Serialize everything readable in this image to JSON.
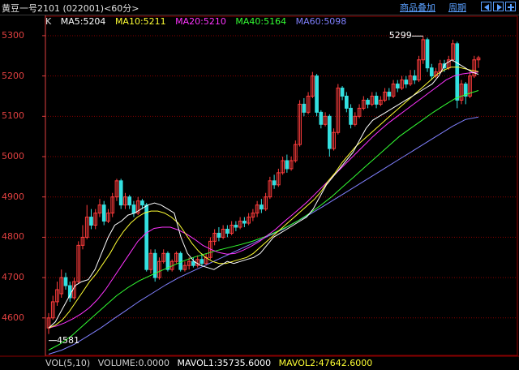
{
  "window": {
    "title": "黄豆一号2101 (022001)<60分>",
    "overlay_label": "商品叠加",
    "period_label": "周期"
  },
  "legend": {
    "k": "K",
    "ma5": "MA5:5204",
    "ma10": "MA10:5211",
    "ma20": "MA20:5210",
    "ma40": "MA40:5164",
    "ma60": "MA60:5098"
  },
  "volume": {
    "label": "VOL(5,10)",
    "volume": "VOLUME:0.0000",
    "mavol1": "MAVOL1:35735.6000",
    "mavol2": "MAVOL2:47642.6000"
  },
  "annotations": {
    "high": "5299",
    "low": "4581"
  },
  "colors": {
    "background": "#000000",
    "up": "#ff3c3c",
    "down": "#33e0e0",
    "grid": "#8b0000",
    "axis": "#e04040",
    "ma5": "#ffffff",
    "ma10": "#ffff33",
    "ma20": "#ff33ff",
    "ma40": "#33ff33",
    "ma60": "#8080ff"
  },
  "chart_data": {
    "type": "candlestick",
    "ylim": [
      4505,
      5320
    ],
    "y_ticks": [
      "5300",
      "5200",
      "5100",
      "5000",
      "4900",
      "4800",
      "4700",
      "4600"
    ],
    "candles": [
      [
        4575,
        4600,
        4560,
        4612
      ],
      [
        4600,
        4640,
        4595,
        4655
      ],
      [
        4640,
        4670,
        4630,
        4690
      ],
      [
        4660,
        4700,
        4650,
        4720
      ],
      [
        4700,
        4680,
        4670,
        4712
      ],
      [
        4680,
        4650,
        4640,
        4690
      ],
      [
        4650,
        4690,
        4645,
        4700
      ],
      [
        4690,
        4780,
        4685,
        4790
      ],
      [
        4780,
        4800,
        4770,
        4830
      ],
      [
        4800,
        4850,
        4795,
        4880
      ],
      [
        4850,
        4830,
        4820,
        4870
      ],
      [
        4830,
        4860,
        4820,
        4870
      ],
      [
        4860,
        4880,
        4850,
        4895
      ],
      [
        4880,
        4840,
        4830,
        4890
      ],
      [
        4840,
        4860,
        4835,
        4870
      ],
      [
        4860,
        4900,
        4850,
        4910
      ],
      [
        4900,
        4940,
        4890,
        4945
      ],
      [
        4940,
        4880,
        4870,
        4945
      ],
      [
        4880,
        4900,
        4870,
        4910
      ],
      [
        4900,
        4880,
        4870,
        4905
      ],
      [
        4880,
        4860,
        4850,
        4890
      ],
      [
        4860,
        4890,
        4855,
        4900
      ],
      [
        4890,
        4880,
        4870,
        4895
      ],
      [
        4880,
        4720,
        4715,
        4885
      ],
      [
        4720,
        4760,
        4710,
        4770
      ],
      [
        4760,
        4700,
        4690,
        4770
      ],
      [
        4700,
        4740,
        4695,
        4750
      ],
      [
        4740,
        4760,
        4735,
        4770
      ],
      [
        4760,
        4720,
        4715,
        4765
      ],
      [
        4720,
        4740,
        4715,
        4745
      ],
      [
        4740,
        4760,
        4735,
        4765
      ],
      [
        4760,
        4720,
        4715,
        4765
      ],
      [
        4720,
        4730,
        4715,
        4740
      ],
      [
        4730,
        4740,
        4720,
        4750
      ],
      [
        4740,
        4730,
        4725,
        4750
      ],
      [
        4730,
        4745,
        4725,
        4755
      ],
      [
        4745,
        4735,
        4730,
        4760
      ],
      [
        4735,
        4750,
        4730,
        4760
      ],
      [
        4750,
        4790,
        4745,
        4800
      ],
      [
        4790,
        4810,
        4780,
        4820
      ],
      [
        4810,
        4800,
        4790,
        4825
      ],
      [
        4800,
        4820,
        4795,
        4830
      ],
      [
        4820,
        4810,
        4800,
        4830
      ],
      [
        4810,
        4830,
        4805,
        4840
      ],
      [
        4830,
        4825,
        4815,
        4840
      ],
      [
        4825,
        4840,
        4820,
        4850
      ],
      [
        4840,
        4835,
        4825,
        4850
      ],
      [
        4835,
        4850,
        4830,
        4860
      ],
      [
        4850,
        4860,
        4840,
        4870
      ],
      [
        4860,
        4880,
        4850,
        4890
      ],
      [
        4880,
        4870,
        4860,
        4895
      ],
      [
        4870,
        4900,
        4865,
        4910
      ],
      [
        4900,
        4940,
        4895,
        4950
      ],
      [
        4940,
        4930,
        4920,
        4955
      ],
      [
        4930,
        4960,
        4925,
        4970
      ],
      [
        4960,
        4990,
        4955,
        5000
      ],
      [
        4990,
        4970,
        4960,
        5005
      ],
      [
        4970,
        4990,
        4965,
        5000
      ],
      [
        4990,
        5030,
        4985,
        5040
      ],
      [
        5030,
        5130,
        5025,
        5140
      ],
      [
        5130,
        5110,
        5100,
        5145
      ],
      [
        5110,
        5150,
        5105,
        5160
      ],
      [
        5150,
        5200,
        5145,
        5210
      ],
      [
        5200,
        5110,
        5100,
        5205
      ],
      [
        5110,
        5080,
        5070,
        5115
      ],
      [
        5080,
        5100,
        5075,
        5110
      ],
      [
        5100,
        5020,
        5000,
        5105
      ],
      [
        5020,
        5060,
        5015,
        5070
      ],
      [
        5060,
        5170,
        5055,
        5180
      ],
      [
        5170,
        5150,
        5140,
        5175
      ],
      [
        5150,
        5120,
        5110,
        5160
      ],
      [
        5120,
        5080,
        5070,
        5130
      ],
      [
        5080,
        5100,
        5075,
        5110
      ],
      [
        5100,
        5120,
        5095,
        5130
      ],
      [
        5120,
        5140,
        5115,
        5150
      ],
      [
        5140,
        5130,
        5120,
        5145
      ],
      [
        5130,
        5150,
        5125,
        5160
      ],
      [
        5150,
        5130,
        5120,
        5160
      ],
      [
        5130,
        5140,
        5125,
        5150
      ],
      [
        5140,
        5160,
        5135,
        5170
      ],
      [
        5160,
        5150,
        5140,
        5170
      ],
      [
        5150,
        5180,
        5145,
        5190
      ],
      [
        5180,
        5170,
        5160,
        5190
      ],
      [
        5170,
        5190,
        5165,
        5200
      ],
      [
        5190,
        5180,
        5170,
        5200
      ],
      [
        5180,
        5200,
        5175,
        5215
      ],
      [
        5200,
        5190,
        5180,
        5215
      ],
      [
        5190,
        5240,
        5185,
        5250
      ],
      [
        5240,
        5290,
        5230,
        5299
      ],
      [
        5290,
        5220,
        5210,
        5295
      ],
      [
        5220,
        5200,
        5190,
        5230
      ],
      [
        5200,
        5210,
        5195,
        5220
      ],
      [
        5210,
        5230,
        5205,
        5240
      ],
      [
        5230,
        5220,
        5210,
        5240
      ],
      [
        5220,
        5240,
        5215,
        5250
      ],
      [
        5240,
        5280,
        5235,
        5290
      ],
      [
        5280,
        5140,
        5120,
        5285
      ],
      [
        5140,
        5180,
        5130,
        5190
      ],
      [
        5180,
        5150,
        5130,
        5185
      ],
      [
        5150,
        5200,
        5145,
        5210
      ],
      [
        5200,
        5240,
        5195,
        5250
      ],
      [
        5240,
        5245,
        5220,
        5250
      ]
    ],
    "ma5": [
      4575,
      4590,
      4620,
      4650,
      4680,
      4690,
      4695,
      4720,
      4760,
      4800,
      4830,
      4840,
      4855,
      4860,
      4870,
      4880,
      4885,
      4880,
      4870,
      4860,
      4800,
      4760,
      4740,
      4730,
      4725,
      4720,
      4730,
      4740,
      4735,
      4740,
      4745,
      4750,
      4760,
      4780,
      4800,
      4810,
      4820,
      4830,
      4840,
      4850,
      4870,
      4900,
      4930,
      4950,
      4970,
      4990,
      5010,
      5040,
      5070,
      5090,
      5100,
      5110,
      5120,
      5130,
      5140,
      5150,
      5160,
      5170,
      5180,
      5200,
      5230,
      5240,
      5230,
      5220,
      5210,
      5204
    ],
    "ma10": [
      4575,
      4582,
      4595,
      4615,
      4640,
      4665,
      4690,
      4710,
      4735,
      4760,
      4790,
      4815,
      4835,
      4850,
      4860,
      4865,
      4865,
      4860,
      4850,
      4835,
      4810,
      4785,
      4765,
      4750,
      4740,
      4735,
      4735,
      4740,
      4745,
      4750,
      4760,
      4775,
      4790,
      4805,
      4820,
      4835,
      4850,
      4865,
      4880,
      4895,
      4915,
      4940,
      4960,
      4985,
      5005,
      5025,
      5040,
      5055,
      5070,
      5085,
      5100,
      5115,
      5130,
      5145,
      5160,
      5175,
      5190,
      5205,
      5215,
      5222,
      5222,
      5218,
      5214,
      5211
    ],
    "ma20": [
      4575,
      4580,
      4588,
      4598,
      4610,
      4625,
      4645,
      4670,
      4700,
      4730,
      4760,
      4790,
      4810,
      4822,
      4825,
      4825,
      4818,
      4808,
      4795,
      4780,
      4770,
      4762,
      4758,
      4760,
      4768,
      4778,
      4790,
      4805,
      4820,
      4838,
      4855,
      4872,
      4890,
      4910,
      4930,
      4950,
      4970,
      4990,
      5010,
      5030,
      5050,
      5068,
      5085,
      5100,
      5115,
      5130,
      5145,
      5160,
      5175,
      5190,
      5200,
      5205,
      5208,
      5210
    ],
    "ma40": [
      4520,
      4535,
      4555,
      4580,
      4605,
      4630,
      4655,
      4675,
      4692,
      4705,
      4718,
      4730,
      4742,
      4752,
      4760,
      4768,
      4775,
      4782,
      4790,
      4800,
      4812,
      4825,
      4840,
      4858,
      4878,
      4900,
      4925,
      4950,
      4975,
      5000,
      5025,
      5050,
      5070,
      5090,
      5110,
      5128,
      5145,
      5155,
      5164
    ],
    "ma60": [
      4510,
      4520,
      4535,
      4555,
      4575,
      4598,
      4620,
      4642,
      4662,
      4682,
      4700,
      4715,
      4730,
      4745,
      4760,
      4775,
      4790,
      4805,
      4820,
      4838,
      4856,
      4875,
      4895,
      4915,
      4935,
      4955,
      4975,
      4995,
      5015,
      5035,
      5055,
      5075,
      5092,
      5098
    ]
  }
}
